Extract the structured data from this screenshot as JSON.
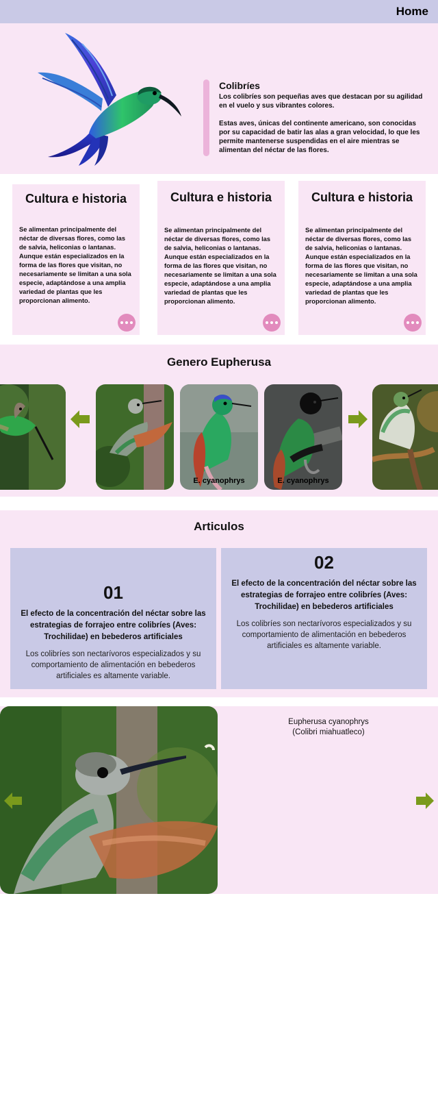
{
  "nav": {
    "home_label": "Home"
  },
  "hero": {
    "title": "Colibríes",
    "paragraph1": "Los colibríes son pequeñas aves que destacan por su agilidad en el vuelo y sus vibrantes colores.",
    "paragraph2": "Estas aves, únicas del continente americano, son conocidas por su capacidad de batir las alas a gran velocidad, lo que les permite mantenerse suspendidas en el aire mientras se alimentan del néctar de las flores."
  },
  "cards": [
    {
      "title": "Cultura e historia",
      "body": "Se alimentan principalmente del néctar de diversas flores, como las de salvia, heliconias o lantanas. Aunque están especializados en la forma de las flores que visitan, no necesariamente se limitan a una sola especie, adaptándose a una amplia variedad de plantas que les proporcionan alimento."
    },
    {
      "title": "Cultura e historia",
      "body": "Se alimentan principalmente del néctar de diversas flores, como las de salvia, heliconias o lantanas. Aunque están especializados en la forma de las flores que visitan, no necesariamente se limitan a una sola especie, adaptándose a una amplia variedad de plantas que les proporcionan alimento."
    },
    {
      "title": "Cultura e historia",
      "body": "Se alimentan principalmente del néctar de diversas flores, como las de salvia, heliconias o lantanas. Aunque están especializados en la forma de las flores que visitan, no necesariamente se limitan a una sola especie, adaptándose a una amplia variedad de plantas que les proporcionan alimento."
    }
  ],
  "genero": {
    "title": "Genero Eupherusa",
    "captions": [
      "E. cyanophrys",
      "E. cyanophrys"
    ]
  },
  "articulos": {
    "title": "Articulos",
    "items": [
      {
        "number": "01",
        "title": "El efecto de la concentración del néctar sobre las estrategias de forrajeo entre colibríes (Aves: Trochilidae) en bebederos artificiales",
        "body": "Los colibríes son nectarívoros especializados y su comportamiento de alimentación en bebederos artificiales es altamente variable."
      },
      {
        "number": "02",
        "title": "El efecto de la concentración del néctar sobre las estrategias de forrajeo entre colibríes (Aves: Trochilidae) en bebederos artificiales",
        "body": "Los colibríes son nectarívoros especializados y su comportamiento de alimentación en bebederos artificiales es altamente variable."
      }
    ]
  },
  "feature": {
    "species": "Eupherusa cyanophrys",
    "common_name": "(Colibri miahuatleco)"
  },
  "colors": {
    "nav_bg": "#c9c9e6",
    "section_bg": "#f9e6f5",
    "accent_pink": "#e28bbd",
    "arrow_green": "#7a9a1c",
    "article_bg": "#c9c9e6"
  }
}
